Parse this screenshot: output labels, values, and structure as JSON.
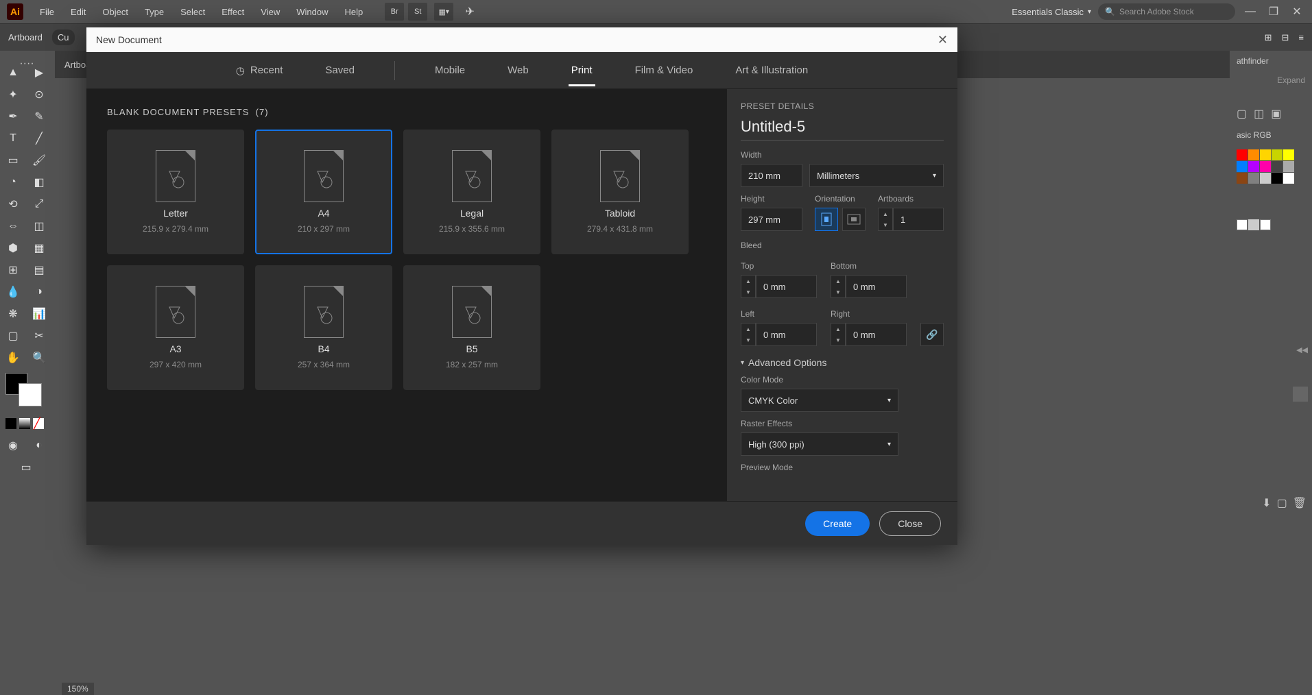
{
  "app": {
    "logo": "Ai"
  },
  "menubar": {
    "items": [
      "File",
      "Edit",
      "Object",
      "Type",
      "Select",
      "Effect",
      "View",
      "Window",
      "Help"
    ]
  },
  "topIcons": {
    "br": "Br",
    "st": "St"
  },
  "workspace": {
    "label": "Essentials Classic"
  },
  "searchStock": {
    "placeholder": "Search Adobe Stock"
  },
  "secondbar": {
    "artboard": "Artboard",
    "cu": "Cu"
  },
  "doctab": {
    "label": "Artboa"
  },
  "zoom": {
    "value": "150%"
  },
  "rightPanels": {
    "pathfinder": "athfinder",
    "expand": "Expand",
    "basicRGB": "asic RGB"
  },
  "swatches": {
    "row1": [
      "#ff0000",
      "#ff8c00",
      "#ffd500",
      "#c8d400",
      "#ffff00"
    ],
    "row2": [
      "#007fff",
      "#b400ff",
      "#ff00aa",
      "#444444",
      "#aaaaaa"
    ],
    "row3": [
      "#8b4513",
      "#808080",
      "#cccccc",
      "#000000",
      "#ffffff"
    ],
    "row4": [
      "#ffffff",
      "#cccccc",
      "#ffffff",
      "#ffffff",
      "#ffffff"
    ]
  },
  "modal": {
    "title": "New Document",
    "tabs": {
      "recent": "Recent",
      "saved": "Saved",
      "mobile": "Mobile",
      "web": "Web",
      "print": "Print",
      "film": "Film & Video",
      "art": "Art & Illustration"
    },
    "presetsHeader": "BLANK DOCUMENT PRESETS",
    "presetsCount": "(7)",
    "presets": [
      {
        "name": "Letter",
        "dim": "215.9 x 279.4 mm"
      },
      {
        "name": "A4",
        "dim": "210 x 297 mm"
      },
      {
        "name": "Legal",
        "dim": "215.9 x 355.6 mm"
      },
      {
        "name": "Tabloid",
        "dim": "279.4 x 431.8 mm"
      },
      {
        "name": "A3",
        "dim": "297 x 420 mm"
      },
      {
        "name": "B4",
        "dim": "257 x 364 mm"
      },
      {
        "name": "B5",
        "dim": "182 x 257 mm"
      }
    ],
    "details": {
      "header": "PRESET DETAILS",
      "docName": "Untitled-5",
      "widthLabel": "Width",
      "width": "210 mm",
      "units": "Millimeters",
      "heightLabel": "Height",
      "height": "297 mm",
      "orientLabel": "Orientation",
      "artboardsLabel": "Artboards",
      "artboards": "1",
      "bleedLabel": "Bleed",
      "topLabel": "Top",
      "top": "0 mm",
      "bottomLabel": "Bottom",
      "bottom": "0 mm",
      "leftLabel": "Left",
      "left": "0 mm",
      "rightLabel": "Right",
      "right": "0 mm",
      "advLabel": "Advanced Options",
      "colorModeLabel": "Color Mode",
      "colorMode": "CMYK Color",
      "rasterLabel": "Raster Effects",
      "raster": "High (300 ppi)",
      "previewLabel": "Preview Mode"
    },
    "buttons": {
      "create": "Create",
      "close": "Close"
    }
  }
}
